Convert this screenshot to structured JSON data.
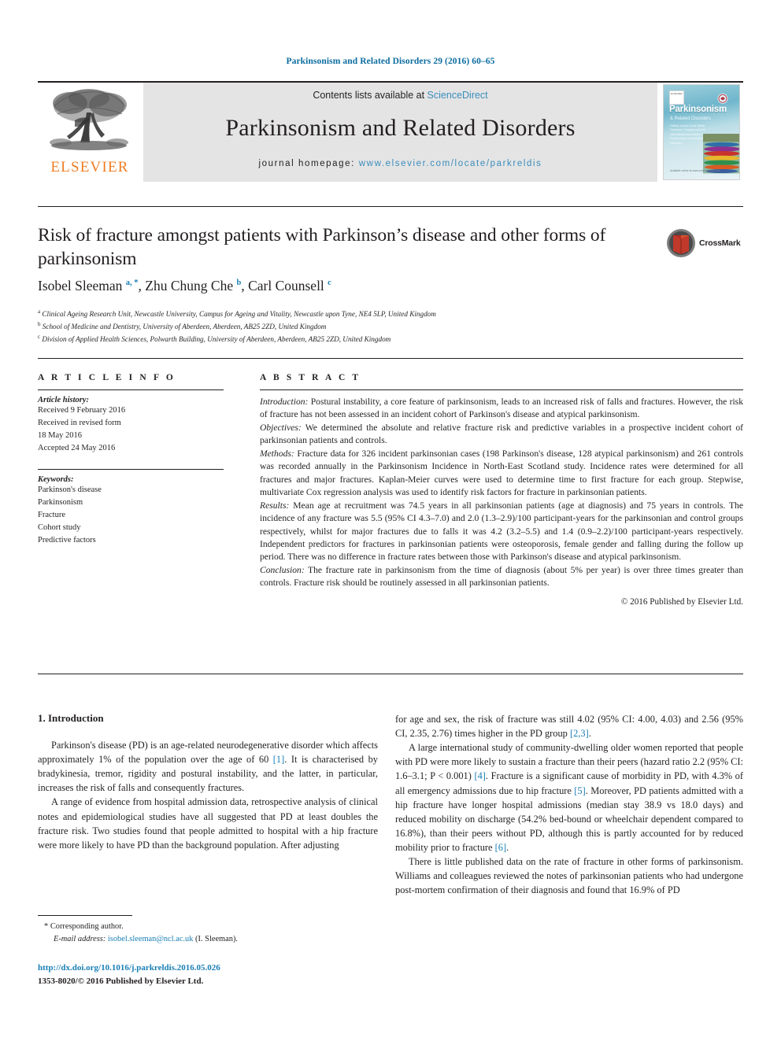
{
  "running_head": "Parkinsonism and Related Disorders 29 (2016) 60–65",
  "masthead": {
    "publisher": "ELSEVIER",
    "contents_prefix": "Contents lists available at ",
    "contents_link": "ScienceDirect",
    "journal_title": "Parkinsonism and Related Disorders",
    "homepage_prefix": "journal homepage: ",
    "homepage_url": "www.elsevier.com/locate/parkreldis",
    "cover": {
      "title": "Parkinsonism",
      "subtitle": "& Related Disorders",
      "blurb": "Official Journal of the World Parkinson Congress and the International Association of Parkinsonism and Related Disorders",
      "publisher_mark": "ELSEVIER",
      "footer": "Available online at www.sciencedirect.com"
    }
  },
  "article": {
    "title": "Risk of fracture amongst patients with Parkinson’s disease and other forms of parkinsonism",
    "crossmark_label": "CrossMark",
    "authors": [
      {
        "name": "Isobel Sleeman",
        "marks": "a, *"
      },
      {
        "name": "Zhu Chung Che",
        "marks": "b"
      },
      {
        "name": "Carl Counsell",
        "marks": "c"
      }
    ],
    "affiliations": [
      {
        "mark": "a",
        "text": "Clinical Ageing Research Unit, Newcastle University, Campus for Ageing and Vitality, Newcastle upon Tyne, NE4 5LP, United Kingdom"
      },
      {
        "mark": "b",
        "text": "School of Medicine and Dentistry, University of Aberdeen, Aberdeen, AB25 2ZD, United Kingdom"
      },
      {
        "mark": "c",
        "text": "Division of Applied Health Sciences, Polwarth Building, University of Aberdeen, Aberdeen, AB25 2ZD, United Kingdom"
      }
    ]
  },
  "article_info": {
    "heading": "A R T I C L E   I N F O",
    "history_label": "Article history:",
    "history": [
      "Received 9 February 2016",
      "Received in revised form",
      "18 May 2016",
      "Accepted 24 May 2016"
    ],
    "keywords_label": "Keywords:",
    "keywords": [
      "Parkinson's disease",
      "Parkinsonism",
      "Fracture",
      "Cohort study",
      "Predictive factors"
    ]
  },
  "abstract": {
    "heading": "A B S T R A C T",
    "sections": [
      {
        "label": "Introduction:",
        "text": " Postural instability, a core feature of parkinsonism, leads to an increased risk of falls and fractures. However, the risk of fracture has not been assessed in an incident cohort of Parkinson's disease and atypical parkinsonism."
      },
      {
        "label": "Objectives:",
        "text": " We determined the absolute and relative fracture risk and predictive variables in a prospective incident cohort of parkinsonian patients and controls."
      },
      {
        "label": "Methods:",
        "text": " Fracture data for 326 incident parkinsonian cases (198 Parkinson's disease, 128 atypical parkinsonism) and 261 controls was recorded annually in the Parkinsonism Incidence in North-East Scotland study. Incidence rates were determined for all fractures and major fractures. Kaplan-Meier curves were used to determine time to first fracture for each group. Stepwise, multivariate Cox regression analysis was used to identify risk factors for fracture in parkinsonian patients."
      },
      {
        "label": "Results:",
        "text": " Mean age at recruitment was 74.5 years in all parkinsonian patients (age at diagnosis) and 75 years in controls. The incidence of any fracture was 5.5 (95% CI 4.3–7.0) and 2.0 (1.3–2.9)/100 participant-years for the parkinsonian and control groups respectively, whilst for major fractures due to falls it was 4.2 (3.2–5.5) and 1.4 (0.9–2.2)/100 participant-years respectively. Independent predictors for fractures in parkinsonian patients were osteoporosis, female gender and falling during the follow up period. There was no difference in fracture rates between those with Parkinson's disease and atypical parkinsonism."
      },
      {
        "label": "Conclusion:",
        "text": "  The fracture rate in parkinsonism from the time of diagnosis (about 5% per year) is over three times greater than controls. Fracture risk should be routinely assessed in all parkinsonian patients."
      }
    ],
    "copyright": "© 2016 Published by Elsevier Ltd."
  },
  "body": {
    "section_number_title": "1.  Introduction",
    "left_paragraphs": [
      "Parkinson's disease (PD) is an age-related neurodegenerative disorder which affects approximately 1% of the population over the age of 60 [1]. It is characterised by bradykinesia, tremor, rigidity and postural instability, and the latter, in particular, increases the risk of falls and consequently fractures.",
      "A range of evidence from hospital admission data, retrospective analysis of clinical notes and epidemiological studies have all suggested that PD at least doubles the fracture risk. Two studies found that people admitted to hospital with a hip fracture were more likely to have PD than the background population. After adjusting"
    ],
    "right_paragraphs": [
      "for age and sex, the risk of fracture was still 4.02 (95% CI: 4.00, 4.03) and 2.56 (95% CI, 2.35, 2.76) times higher in the PD group [2,3].",
      "A large international study of community-dwelling older women reported that people with PD were more likely to sustain a fracture than their peers (hazard ratio 2.2 (95% CI: 1.6–3.1; P < 0.001) [4]. Fracture is a significant cause of morbidity in PD, with 4.3% of all emergency admissions due to hip fracture [5]. Moreover, PD patients admitted with a hip fracture have longer hospital admissions (median stay 38.9 vs 18.0 days) and reduced mobility on discharge (54.2% bed-bound or wheelchair dependent compared to 16.8%), than their peers without PD, although this is partly accounted for by reduced mobility prior to fracture [6].",
      "There is little published data on the rate of fracture in other forms of parkinsonism. Williams and colleagues reviewed the notes of parkinsonian patients who had undergone post-mortem confirmation of their diagnosis and found that 16.9% of PD"
    ]
  },
  "footer": {
    "corresponding_marker": "*",
    "corresponding_label": "Corresponding author.",
    "email_label": "E-mail address:",
    "email": "isobel.sleeman@ncl.ac.uk",
    "email_suffix": "(I. Sleeman).",
    "doi_url": "http://dx.doi.org/10.1016/j.parkreldis.2016.05.026",
    "issn_line": "1353-8020/© 2016 Published by Elsevier Ltd."
  }
}
